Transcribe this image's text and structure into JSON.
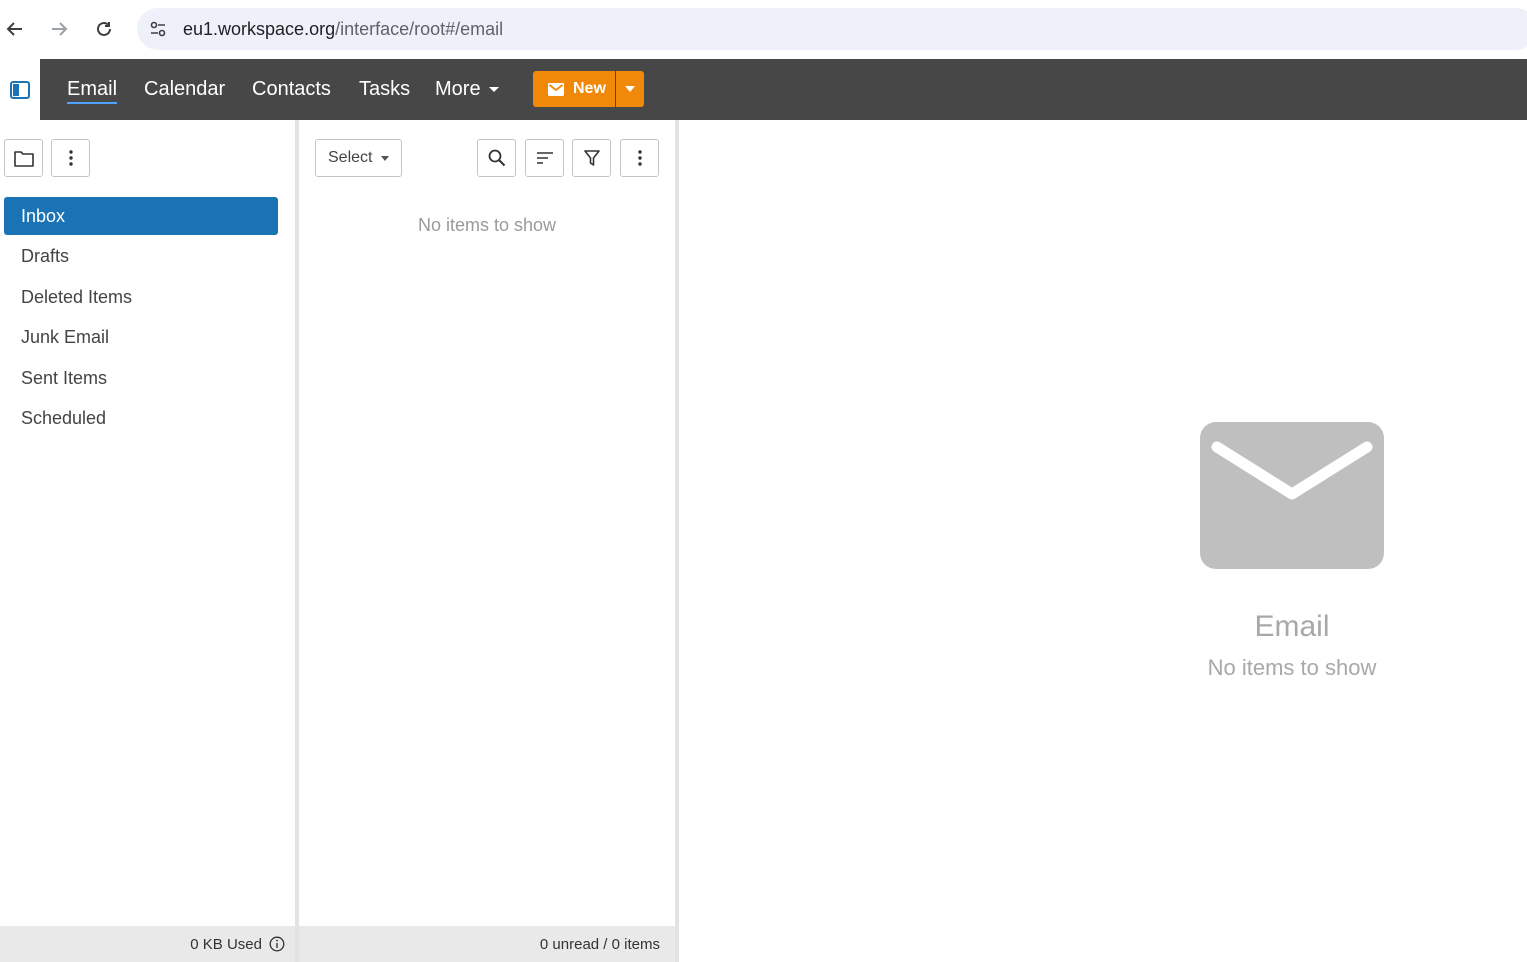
{
  "browser": {
    "url_host": "eu1.workspace.org",
    "url_path": "/interface/root#/email"
  },
  "nav": {
    "items": [
      {
        "label": "Email"
      },
      {
        "label": "Calendar"
      },
      {
        "label": "Contacts"
      },
      {
        "label": "Tasks"
      },
      {
        "label": "More"
      }
    ],
    "new_label": "New",
    "accent": "#f0890a"
  },
  "folders": {
    "items": [
      {
        "label": "Inbox"
      },
      {
        "label": "Drafts"
      },
      {
        "label": "Deleted Items"
      },
      {
        "label": "Junk Email"
      },
      {
        "label": "Sent Items"
      },
      {
        "label": "Scheduled"
      }
    ],
    "storage": "0 KB Used",
    "active_color": "#1a73b5"
  },
  "list": {
    "select_label": "Select",
    "empty_text": "No items to show",
    "footer": "0 unread / 0 items"
  },
  "reading": {
    "title": "Email",
    "subtitle": "No items to show"
  },
  "icons": [
    "back-icon",
    "forward-icon",
    "reload-icon",
    "site-settings-icon",
    "sidebar-toggle-icon",
    "mail-icon",
    "folder-icon",
    "kebab-icon",
    "search-icon",
    "sort-icon",
    "filter-icon",
    "info-icon",
    "envelope-icon"
  ]
}
